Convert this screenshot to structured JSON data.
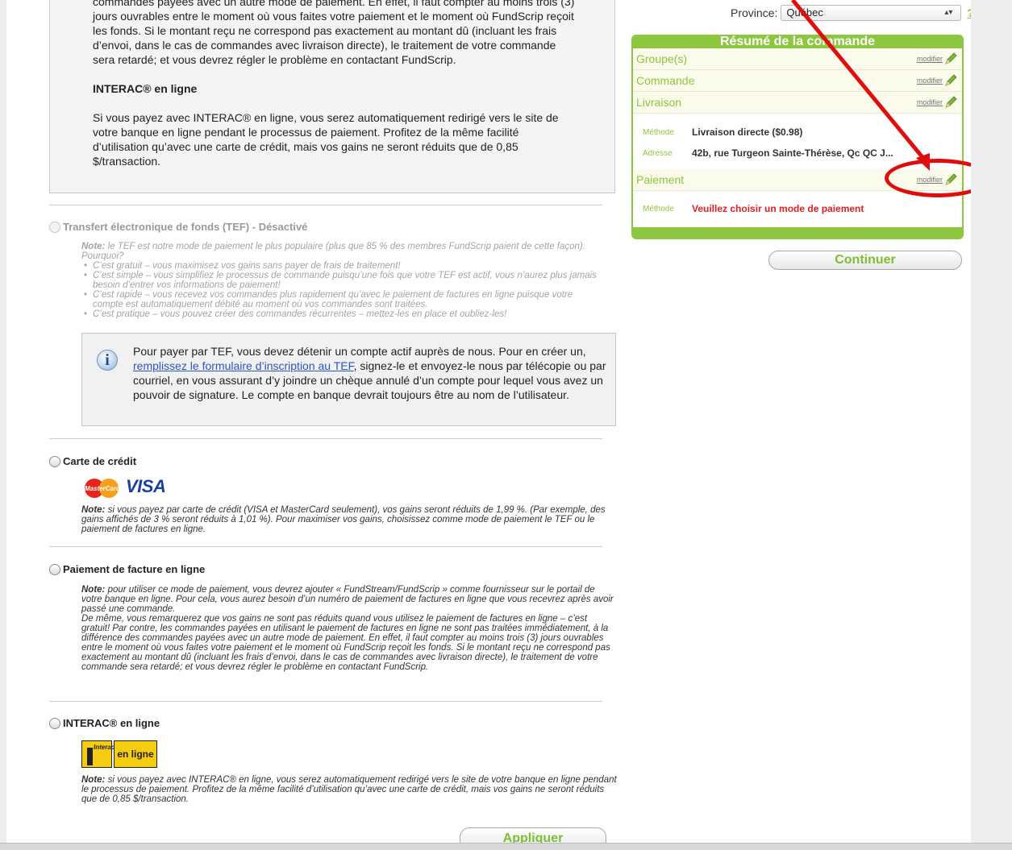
{
  "top_box": {
    "text_fragment": "commandes payées avec un autre mode de paiement. En effet, il faut compter au moins trois (3) jours ouvrables entre le moment où vous faites votre paiement et le moment où FundScrip reçoit les fonds. Si le montant reçu ne correspond pas exactement au montant dû (incluant les frais d’envoi, dans le cas de commandes avec livraison directe), le traitement de votre commande sera retardé; et vous devrez régler le problème en contactant FundScrip.",
    "interac_heading": "INTERAC® en ligne",
    "interac_text": "Si vous payez avec INTERAC® en ligne, vous serez automatiquement redirigé vers le site de votre banque en ligne pendant le processus de paiement. Profitez de la même facilité d’utilisation qu’avec une carte de crédit, mais vos gains ne seront réduits que de 0,85 $/transaction."
  },
  "options": {
    "tef": {
      "label": "Transfert électronique de fonds (TEF) - Désactivé",
      "note_label": "Note:",
      "note_intro": " le TEF est notre mode de paiement le plus populaire (plus que 85 % des membres FundScrip paient de cette façon). Pourquoi?",
      "bullets": [
        "C’est gratuit – vous maximisez vos gains sans payer de frais de traitement!",
        "C’est simple – vous simplifiez le processus de commande puisqu’une fois que votre TEF est actif, vous n’aurez plus jamais besoin d’entrer vos informations de paiement!",
        "C’est rapide – vous recevez vos commandes plus rapidement qu’avec le paiement de factures en ligne puisque votre compte est automatiquement débité au moment où vos commandes sont traitées.",
        "C’est pratique – vous pouvez créer des commandes récurrentes – mettez-les en place et oubliez-les!"
      ],
      "info_before": "Pour payer par TEF, vous devez détenir un compte actif auprès de nous. Pour en créer un, ",
      "info_link": "remplissez le formulaire d’inscription au TEF",
      "info_after": ", signez-le et envoyez-le nous par télécopie ou par courriel, en vous assurant d’y joindre un chèque annulé d’un compte pour lequel vous avez un pouvoir de signature. Le compte en banque devrait toujours être au nom de l’utilisateur."
    },
    "credit": {
      "label": "Carte de crédit",
      "mastercard_text": "MasterCard",
      "visa_text": "VISA",
      "note_label": "Note:",
      "note": " si vous payez par carte de crédit (VISA et MasterCard seulement), vos gains seront réduits de 1,99 %. (Par exemple, des gains affichés de 3 % seront réduits à 1,01 %). Pour maximiser vos gains, choisissez comme mode de paiement le TEF ou le paiement de factures en ligne."
    },
    "bill": {
      "label": "Paiement de facture en ligne",
      "note_label": "Note:",
      "note1": " pour utiliser ce mode de paiement, vous devrez ajouter « FundStream/FundScrip » comme fournisseur sur le portail de votre banque en ligne. Pour cela, vous aurez besoin d’un numéro de paiement de factures en ligne que vous recevrez après avoir passé une commande.",
      "note2": "De même, vous remarquerez que vos gains ne sont pas réduits quand vous utilisez le paiement de factures en ligne – c’est gratuit! Par contre, les commandes payées en utilisant le paiement de factures en ligne ne sont pas traitées immédiatement, à la différence des commandes payées avec un autre mode de paiement. En effet, il faut compter au moins trois (3) jours ouvrables entre le moment où vous faites votre paiement et le moment où FundScrip reçoit les fonds. Si le montant reçu ne correspond pas exactement au montant dû (incluant les frais d’envoi, dans le cas de commandes avec livraison directe), le traitement de votre commande sera retardé; et vous devrez régler le problème en contactant FundScrip."
    },
    "interac": {
      "label": "INTERAC® en ligne",
      "logo_small": "Interac",
      "logo_text": "en ligne",
      "note_label": "Note:",
      "note": " si vous payez avec INTERAC® en ligne, vous serez automatiquement redirigé vers le site de votre banque en ligne pendant le processus de paiement. Profitez de la même facilité d’utilisation qu’avec une carte de crédit, mais vos gains ne seront réduits que de 0,85 $/transaction."
    }
  },
  "buttons": {
    "apply": "Appliquer",
    "continue": "Continuer"
  },
  "province": {
    "label": "Province:",
    "value": "Québec",
    "help": "?"
  },
  "summary": {
    "title": "Résumé de la commande",
    "modify_label": "modifier",
    "rows": {
      "groups": "Groupe(s)",
      "order": "Commande",
      "delivery": "Livraison",
      "payment": "Paiement"
    },
    "delivery_method_key": "Méthode",
    "delivery_method_value": "Livraison directe ($0.98)",
    "delivery_address_key": "Adresse",
    "delivery_address_value": "42b, rue Turgeon Sainte-Thérèse, Qc QC J...",
    "payment_method_key": "Méthode",
    "payment_method_value": "Veuillez choisir un mode de paiement"
  },
  "colors": {
    "brand_green": "#8dc63f",
    "alert_red": "#e02020",
    "callout_red": "#e00d0d",
    "link_blue": "#2b55c9"
  }
}
